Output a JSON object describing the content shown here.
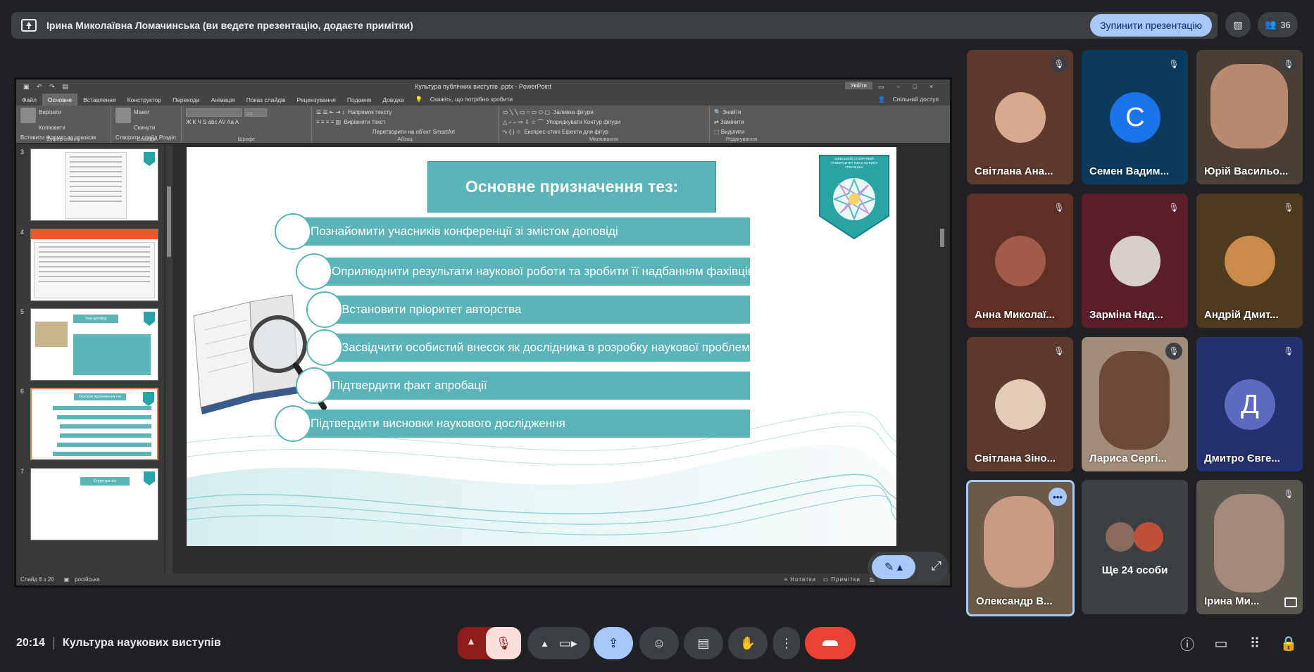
{
  "topbar": {
    "presenter_text": "Ірина Миколаївна Ломачинська (ви ведете презентацію, додаєте примітки)",
    "stop_label": "Зупинити презентацію",
    "people_count": "36"
  },
  "ppt": {
    "doc_title": "Культура публічних виступів .pptx  -  PowerPoint",
    "login_label": "Увійти",
    "menu": [
      "Файл",
      "Основне",
      "Вставлення",
      "Конструктор",
      "Переходи",
      "Анімація",
      "Показ слайдів",
      "Рецензування",
      "Подання",
      "Довідка",
      "Скажіть, що потрібно зробити"
    ],
    "share_label": "Спільний доступ",
    "ribbon": {
      "paste": "Вставити",
      "cut": "Вирізати",
      "copy": "Копіювати",
      "format": "Формат за зразком",
      "clipboard": "Буфер обміну",
      "create": "Створити слайд",
      "layout": "Макет",
      "reset": "Скинути",
      "section": "Розділ",
      "slides": "Слайди",
      "size": "24",
      "font": "Шрифт",
      "text_dir": "Напрямок тексту",
      "align_text": "Вирівняти текст",
      "smartart": "Перетворити на об'єкт SmartArt",
      "paragraph": "Абзац",
      "arrange": "Упорядкувати",
      "quick_styles": "Експрес-стилі",
      "fill": "Заливка фігури",
      "outline": "Контур фігури",
      "effects": "Ефекти для фігур",
      "drawing": "Малювання",
      "find": "Знайти",
      "replace": "Замінити",
      "select": "Виділити",
      "editing": "Редагування"
    },
    "thumbs": [
      {
        "num": "3"
      },
      {
        "num": "4"
      },
      {
        "num": "5",
        "title": "Тези доповіді"
      },
      {
        "num": "6",
        "title": "Основне призначення тез"
      },
      {
        "num": "7",
        "title": "Структура тез"
      }
    ],
    "status": {
      "slide": "Слайд 6 з 20",
      "lang": "російська",
      "notes": "Нотатки",
      "comments": "Примітки"
    }
  },
  "slide": {
    "title": "Основне призначення тез:",
    "logo_text": "КИЇВСЬКИЙ СТОЛИЧНИЙ УНІВЕРСИТЕТ ІМЕНІ БОРИСА ГРІНЧЕНКА",
    "bullets": [
      "Познайомити учасників конференції зі змістом доповіді",
      "Оприлюднити результати наукової роботи та зробити її надбанням фахівців",
      "Встановити пріоритет авторства",
      "Засвідчити особистий внесок як дослідника в розробку наукової проблеми",
      "Підтвердити факт апробації",
      "Підтвердити висновки наукового дослідження"
    ]
  },
  "participants": [
    {
      "name": "Світлана Ана...",
      "bg": "#5c3a2e"
    },
    {
      "name": "Семен Вадим...",
      "bg": "#0b3a5c",
      "initial": "С",
      "avatar_bg": "#1a73e8"
    },
    {
      "name": "Юрій Васильо...",
      "bg": "#4a4038"
    },
    {
      "name": "Анна Миколаї...",
      "bg": "#5e2f24"
    },
    {
      "name": "Зарміна Над...",
      "bg": "#5a1f2a"
    },
    {
      "name": "Андрій Дмит...",
      "bg": "#4d3a1f"
    },
    {
      "name": "Світлана Зіно...",
      "bg": "#5c3a2e"
    },
    {
      "name": "Лариса Сергі...",
      "bg": "#a08c78"
    },
    {
      "name": "Дмитро Євге...",
      "bg": "#25306e",
      "initial": "Д",
      "avatar_bg": "#5c6bc0"
    },
    {
      "name": "Олександр В...",
      "bg": "#6b5a48"
    },
    {
      "name": "Ще 24 особи",
      "bg": "#3c4043"
    },
    {
      "name": "Ірина Ми...",
      "bg": "#5a564e"
    }
  ],
  "bottom": {
    "time": "20:14",
    "meeting": "Культура наукових виступів"
  },
  "colors": {
    "accent": "#a8c7fa",
    "end_call": "#ea4335",
    "slide_teal": "#5bb5b8"
  }
}
